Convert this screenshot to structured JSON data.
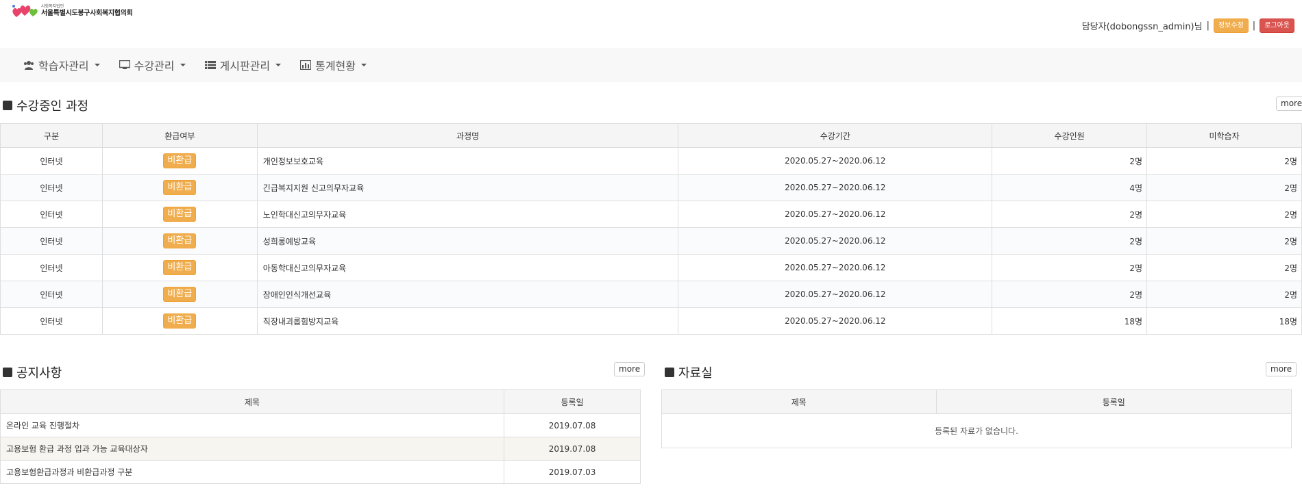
{
  "header": {
    "logo_sub": "사회복지법인",
    "logo_main": "서울특별시도봉구사회복지협의회",
    "user_text": "담당자(dobongssn_admin)님",
    "separator": "|",
    "edit_label": "정보수정",
    "logout_label": "로그아웃",
    "colors": {
      "edit": "#f0ad4e",
      "logout": "#d9534f"
    }
  },
  "nav": {
    "items": [
      {
        "label": "학습자관리",
        "icon": "users-icon"
      },
      {
        "label": "수강관리",
        "icon": "desktop-icon"
      },
      {
        "label": "게시판관리",
        "icon": "list-icon"
      },
      {
        "label": "통계현황",
        "icon": "bar-chart-icon"
      }
    ]
  },
  "courses": {
    "title": "수강중인 과정",
    "more": "more",
    "columns": [
      "구분",
      "환급여부",
      "과정명",
      "수강기간",
      "수강인원",
      "미학습자"
    ],
    "rows": [
      {
        "type": "인터넷",
        "refund": "비환급",
        "name": "개인정보보호교육",
        "period": "2020.05.27~2020.06.12",
        "enrolled": "2명",
        "unlearned": "2명"
      },
      {
        "type": "인터넷",
        "refund": "비환급",
        "name": "긴급복지지원 신고의무자교육",
        "period": "2020.05.27~2020.06.12",
        "enrolled": "4명",
        "unlearned": "2명"
      },
      {
        "type": "인터넷",
        "refund": "비환급",
        "name": "노인학대신고의무자교육",
        "period": "2020.05.27~2020.06.12",
        "enrolled": "2명",
        "unlearned": "2명"
      },
      {
        "type": "인터넷",
        "refund": "비환급",
        "name": "성희롱예방교육",
        "period": "2020.05.27~2020.06.12",
        "enrolled": "2명",
        "unlearned": "2명"
      },
      {
        "type": "인터넷",
        "refund": "비환급",
        "name": "아동학대신고의무자교육",
        "period": "2020.05.27~2020.06.12",
        "enrolled": "2명",
        "unlearned": "2명"
      },
      {
        "type": "인터넷",
        "refund": "비환급",
        "name": "장애인인식개선교육",
        "period": "2020.05.27~2020.06.12",
        "enrolled": "2명",
        "unlearned": "2명"
      },
      {
        "type": "인터넷",
        "refund": "비환급",
        "name": "직장내괴롭힘방지교육",
        "period": "2020.05.27~2020.06.12",
        "enrolled": "18명",
        "unlearned": "18명"
      }
    ]
  },
  "notice": {
    "title": "공지사항",
    "more": "more",
    "columns": [
      "제목",
      "등록일"
    ],
    "rows": [
      {
        "title": "온라인 교육 진행절차",
        "date": "2019.07.08"
      },
      {
        "title": "고용보험 환급 과정 입과 가능 교육대상자",
        "date": "2019.07.08"
      },
      {
        "title": "고용보험환급과정과 비환급과정 구분",
        "date": "2019.07.03"
      }
    ]
  },
  "archive": {
    "title": "자료실",
    "more": "more",
    "columns": [
      "제목",
      "등록일"
    ],
    "empty": "등록된 자료가 없습니다."
  }
}
